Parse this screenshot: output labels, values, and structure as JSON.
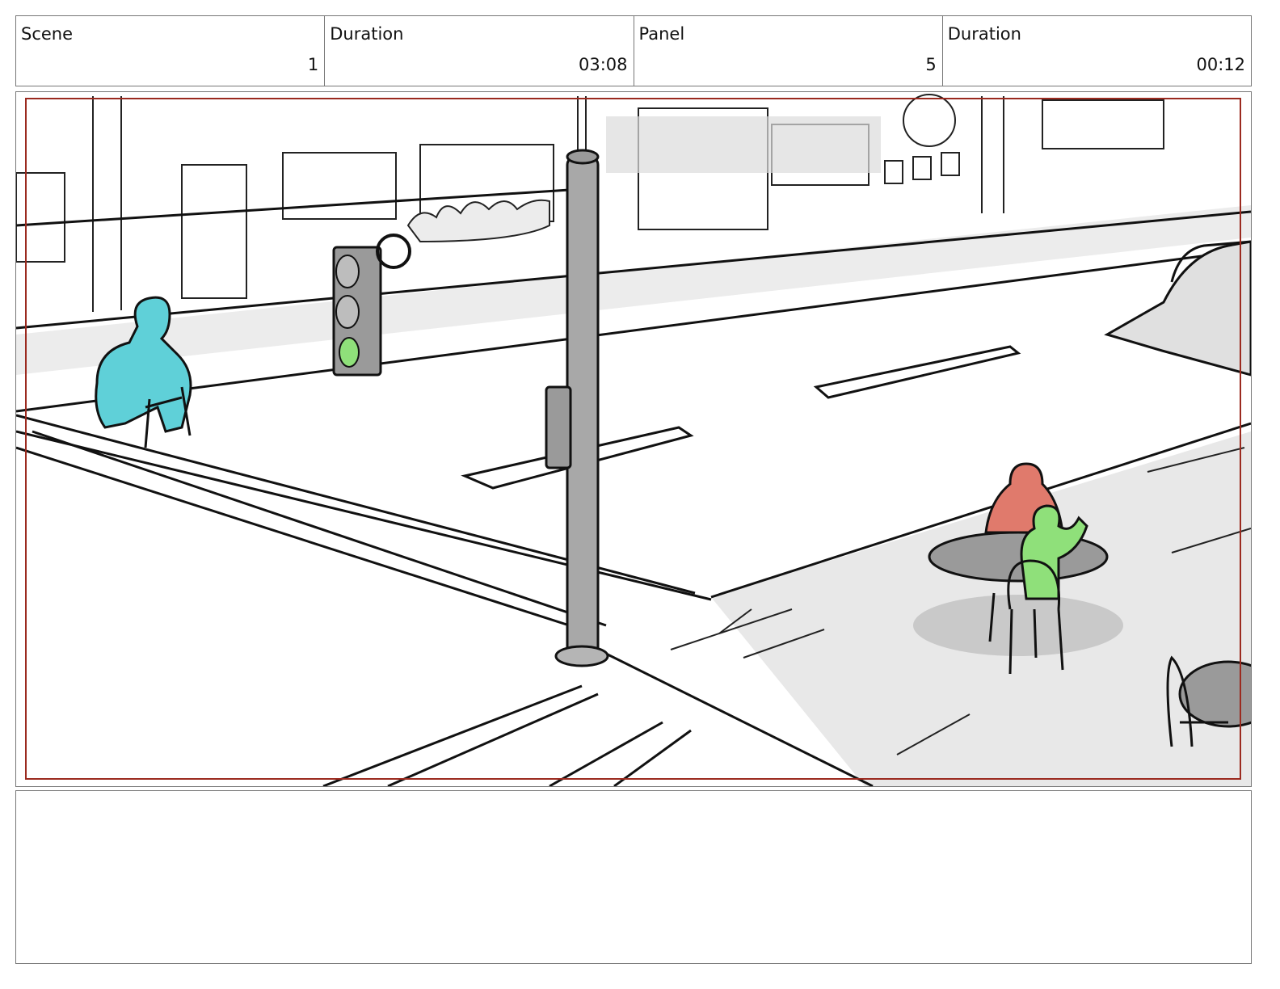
{
  "header": {
    "scene_label": "Scene",
    "scene_value": "1",
    "scene_duration_label": "Duration",
    "scene_duration_value": "03:08",
    "panel_label": "Panel",
    "panel_value": "5",
    "panel_duration_label": "Duration",
    "panel_duration_value": "00:12"
  },
  "frame": {
    "safe_area_color": "#9b2a1f",
    "accent_cyan": "#5fd0d8",
    "accent_red": "#e07a6c",
    "accent_green": "#8fe07a",
    "traffic_light_signal": "green"
  },
  "notes": {
    "text": ""
  }
}
